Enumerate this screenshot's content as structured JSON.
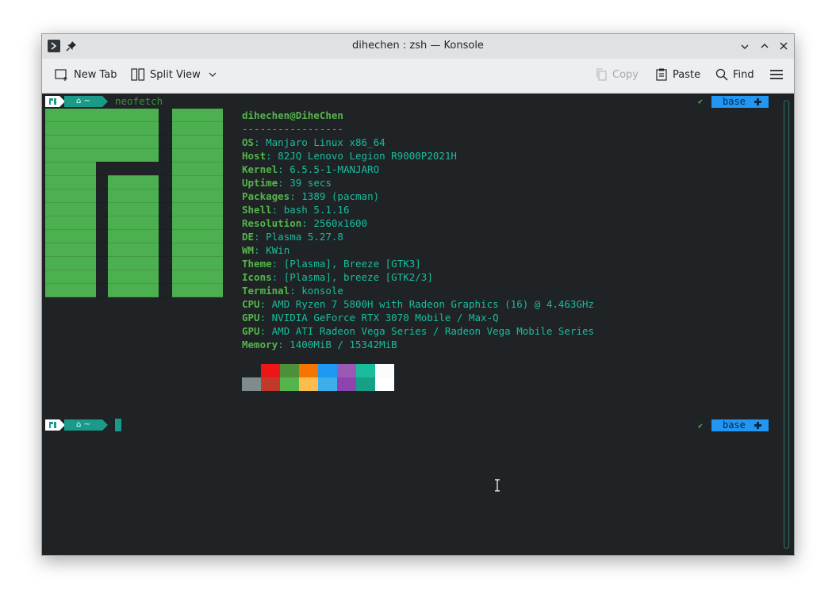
{
  "window": {
    "title": "dihechen : zsh — Konsole"
  },
  "toolbar": {
    "new_tab": "New Tab",
    "split_view": "Split View",
    "copy": "Copy",
    "paste": "Paste",
    "find": "Find"
  },
  "terminal": {
    "prompt_dir_symbol": "⌂ ~",
    "command": "neofetch",
    "status_check": "✔",
    "env_badge": "base",
    "header": "dihechen@DiheChen",
    "separator": "-----------------",
    "info": [
      {
        "key": "OS",
        "value": "Manjaro Linux x86_64"
      },
      {
        "key": "Host",
        "value": "82JQ Lenovo Legion R9000P2021H"
      },
      {
        "key": "Kernel",
        "value": "6.5.5-1-MANJARO"
      },
      {
        "key": "Uptime",
        "value": "39 secs"
      },
      {
        "key": "Packages",
        "value": "1389 (pacman)"
      },
      {
        "key": "Shell",
        "value": "bash 5.1.16"
      },
      {
        "key": "Resolution",
        "value": "2560x1600"
      },
      {
        "key": "DE",
        "value": "Plasma 5.27.8"
      },
      {
        "key": "WM",
        "value": "KWin"
      },
      {
        "key": "Theme",
        "value": "[Plasma], Breeze [GTK3]"
      },
      {
        "key": "Icons",
        "value": "[Plasma], breeze [GTK2/3]"
      },
      {
        "key": "Terminal",
        "value": "konsole"
      },
      {
        "key": "CPU",
        "value": "AMD Ryzen 7 5800H with Radeon Graphics (16) @ 4.463GHz"
      },
      {
        "key": "GPU",
        "value": "NVIDIA GeForce RTX 3070 Mobile / Max-Q"
      },
      {
        "key": "GPU",
        "value": "AMD ATI Radeon Vega Series / Radeon Vega Mobile Series"
      },
      {
        "key": "Memory",
        "value": "1400MiB / 15342MiB"
      }
    ],
    "palette_top": [
      "#1f2326",
      "#ed1515",
      "#4e8f3a",
      "#f67400",
      "#1d99f3",
      "#9b59b6",
      "#1abc9c",
      "#fcfcfc"
    ],
    "palette_bottom": [
      "#7f8c8d",
      "#c0392b",
      "#55b44b",
      "#fdbc4b",
      "#3daee9",
      "#8e44ad",
      "#16a085",
      "#ffffff"
    ],
    "logo_color": "#4caf50",
    "colors": {
      "key": "#55b44b",
      "value": "#1abc9c",
      "background": "#1f2326",
      "accent_blue": "#2196f3",
      "accent_teal": "#1a9b8a"
    }
  }
}
